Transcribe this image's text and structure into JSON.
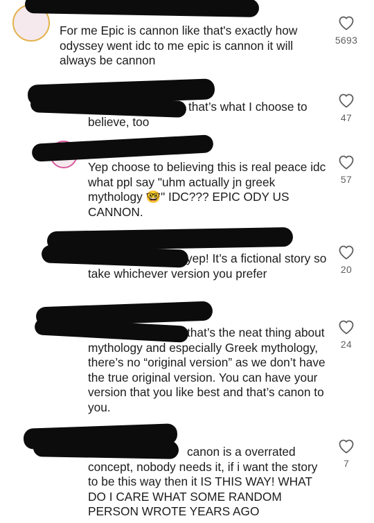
{
  "comments": [
    {
      "text": "For me Epic is cannon like that's exactly how odyssey went idc to me epic is cannon it will always be cannon",
      "likes": "5693"
    },
    {
      "text": "that’s what I choose to believe, too",
      "likes": "47"
    },
    {
      "text": "Yep choose to believing this is real peace idc what ppl say \"uhm actually jn greek mythology 🤓\" IDC??? EPIC ODY US CANNON.",
      "likes": "57"
    },
    {
      "text": "yep! It’s a fictional story so take whichever version you prefer",
      "likes": "20"
    },
    {
      "text": "that’s the neat thing about mythology and especially Greek mythology, there’s no “original version” as we don’t have the true original version. You can have your version that you like best and that’s canon to you.",
      "likes": "24"
    },
    {
      "text": "canon is a overrated concept, nobody needs it, if i want the story to be this way then it IS THIS WAY! WHAT DO I CARE WHAT SOME RANDOM PERSON WROTE YEARS AGO",
      "likes": "7"
    }
  ],
  "icons": {
    "like": "heart-outline-icon",
    "avatar_ring": "story-ring"
  },
  "colors": {
    "text": "#1c1c1c",
    "count": "#5e5e5e",
    "mention": "#4a7bd1",
    "redaction": "#0c0c0c"
  }
}
